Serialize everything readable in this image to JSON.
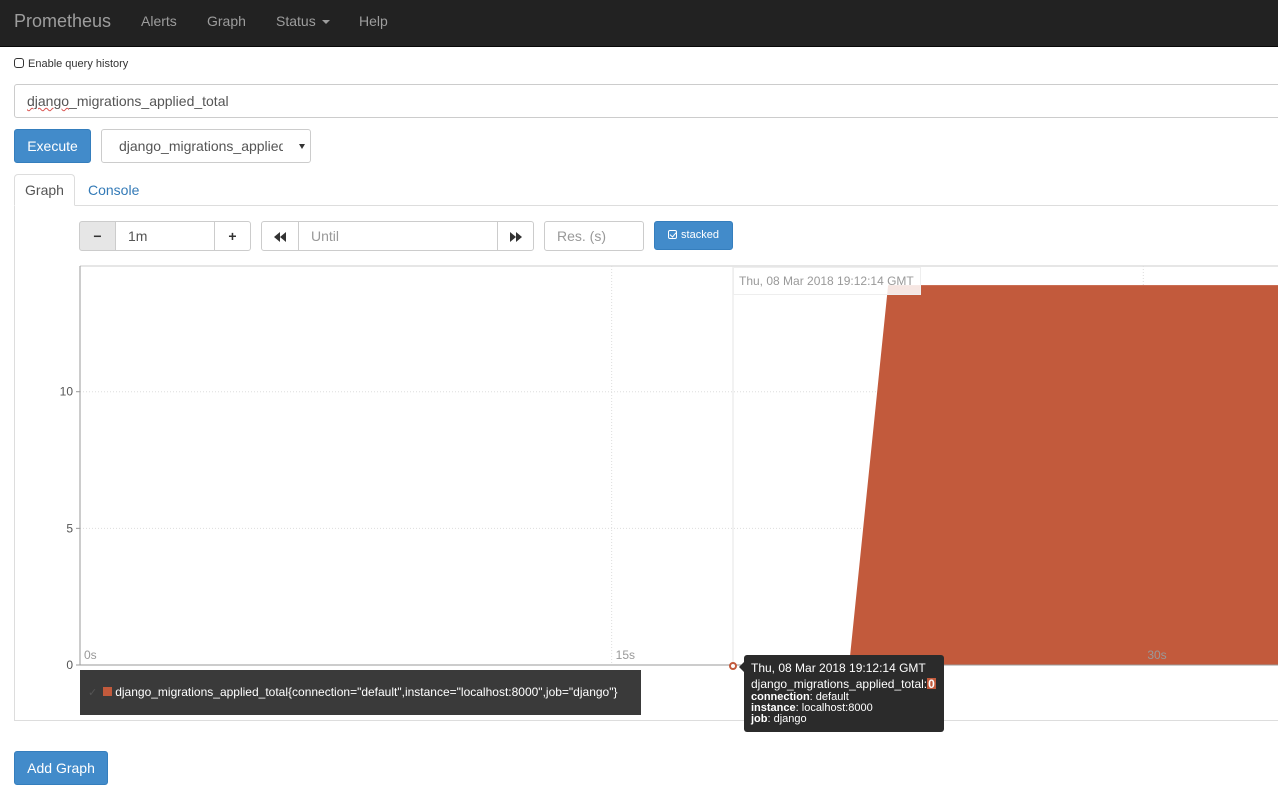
{
  "navbar": {
    "brand": "Prometheus",
    "items": [
      "Alerts",
      "Graph",
      "Status",
      "Help"
    ]
  },
  "history": {
    "label": "Enable query history",
    "checked": false
  },
  "query": {
    "expression_prefix": "django",
    "expression_rest": "_migrations_applied_total",
    "execute_label": "Execute",
    "metric_select_value": "django_migrations_applied_total"
  },
  "tabs": {
    "graph": "Graph",
    "console": "Console"
  },
  "controls": {
    "range_minus": "−",
    "range_value": "1m",
    "range_plus": "+",
    "until_placeholder": "Until",
    "res_placeholder": "Res. (s)",
    "stacked_label": "stacked"
  },
  "chart_data": {
    "type": "area",
    "stacked": true,
    "x_tick_labels": [
      "0s",
      "15s",
      "30s"
    ],
    "y_tick_labels": [
      "0",
      "5",
      "10"
    ],
    "ylim": [
      0,
      14.6
    ],
    "grid": true,
    "series": [
      {
        "name": "django_migrations_applied_total{connection=\"default\",instance=\"localhost:8000\",job=\"django\"}",
        "color": "#c25a3c",
        "points": [
          {
            "t": 0,
            "v": 0
          },
          {
            "t": 21.7,
            "v": 0
          },
          {
            "t": 22.8,
            "v": 13.9
          },
          {
            "t": 33.8,
            "v": 13.9
          }
        ]
      }
    ],
    "hover_date": "Thu, 08 Mar 2018 19:12:14 GMT",
    "x_domain": [
      0,
      33.8
    ]
  },
  "legend": {
    "check": "✓",
    "label": "django_migrations_applied_total{connection=\"default\",instance=\"localhost:8000\",job=\"django\"}"
  },
  "tooltip": {
    "date": "Thu, 08 Mar 2018 19:12:14 GMT",
    "metric": "django_migrations_applied_total:",
    "value": "0",
    "labels": [
      {
        "key": "connection",
        "value": ": default"
      },
      {
        "key": "instance",
        "value": ": localhost:8000"
      },
      {
        "key": "job",
        "value": ": django"
      }
    ]
  },
  "add_graph_label": "Add Graph"
}
